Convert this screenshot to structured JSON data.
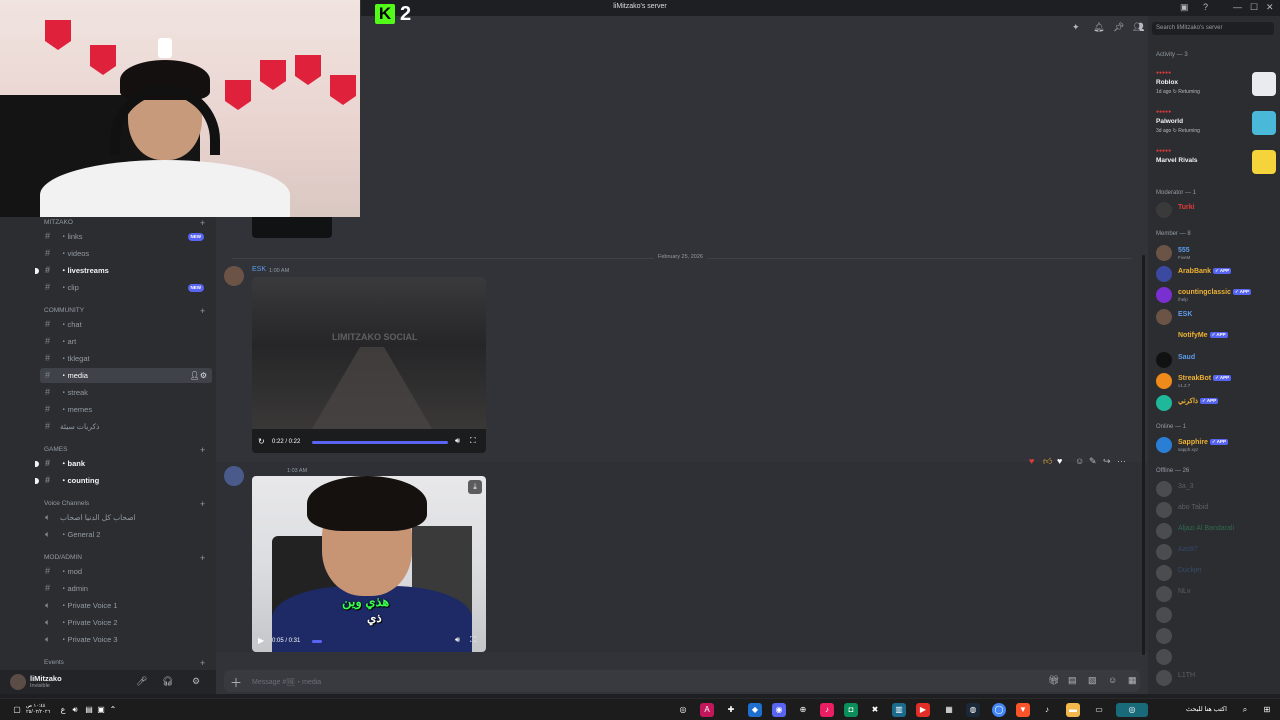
{
  "window": {
    "title": "liMitzako's server",
    "controls": [
      "—",
      "☐",
      "✕"
    ]
  },
  "overlay": {
    "kick_count": "2",
    "kick_letter": "K"
  },
  "sidebar": {
    "categories": [
      {
        "label": "MITZAKO",
        "top": 0
      },
      {
        "label": "COMMUNITY"
      },
      {
        "label": "GAMES"
      },
      {
        "label": "Voice Channels"
      },
      {
        "label": "MOD/ADMIN"
      },
      {
        "label": "Events"
      }
    ],
    "channels": {
      "links": "・links",
      "videos": "・videos",
      "livestreams": "・livestreams",
      "clip": "・clip",
      "chat": "・chat",
      "art": "・art",
      "tklegat": "・tklegat",
      "media": "・media",
      "streak": "・streak",
      "memes": "・memes",
      "arabic": "ذكريات سيئة",
      "bank": "・bank",
      "counting": "・counting",
      "voice_arabic": "اصحاب كل الدنيا اصحاب",
      "general2": "・General 2",
      "mod": "・mod",
      "admin": "・admin",
      "pv1": "・Private Voice 1",
      "pv2": "・Private Voice 2",
      "pv3": "・Private Voice 3"
    },
    "new_badge": "NEW"
  },
  "user": {
    "name": "liMitzako",
    "status": "Invisible"
  },
  "chat": {
    "date_divider": "February 25, 2026",
    "msg1": {
      "author": "ESK",
      "time": "1:00 AM",
      "video_time": "0:22 / 0:22",
      "watermark": "LIMITZAKO SOCIAL"
    },
    "msg2": {
      "author": "",
      "time": "1:03 AM",
      "video_time": "0:05 / 0:31",
      "caption1": "هذي وين",
      "caption2": "ذي"
    },
    "composer_placeholder": "Message #🖼・media"
  },
  "members": {
    "search_placeholder": "Search liMitzako's server",
    "activity_header": "Activity — 3",
    "activities": [
      {
        "game": "Roblox",
        "meta": "1d ago  ↻ Returning",
        "color": "#e9ecef"
      },
      {
        "game": "Palworld",
        "meta": "3d ago  ↻ Returning",
        "color": "#4ab9d9"
      },
      {
        "game": "Marvel Rivals",
        "meta": "",
        "color": "#f5d33a"
      }
    ],
    "moderator_header": "Moderator — 1",
    "moderator": {
      "name": "Turki",
      "color": "#e23b3b"
    },
    "member_header": "Member — 8",
    "list": [
      {
        "name": "555",
        "sub": "FiveM",
        "color": "#5d9cec",
        "tag": ""
      },
      {
        "name": "ArabBank",
        "sub": "",
        "color": "#f0b232",
        "tag": "✓ APP"
      },
      {
        "name": "countingclassic",
        "sub": "/help",
        "color": "#f0b232",
        "tag": "✓ APP"
      },
      {
        "name": "ESK",
        "sub": "",
        "color": "#5d9cec",
        "tag": ""
      },
      {
        "name": "NotifyMe",
        "sub": "",
        "color": "#f0b232",
        "tag": "✓ APP"
      },
      {
        "name": "Saud",
        "sub": "",
        "color": "#5d9cec",
        "tag": ""
      },
      {
        "name": "StreakBot",
        "sub": "v1.2.7",
        "color": "#f0b232",
        "tag": "✓ APP"
      },
      {
        "name": "ذاكرني",
        "sub": "",
        "color": "#f0b232",
        "tag": "✓ APP"
      }
    ],
    "online_header": "Online — 1",
    "online": {
      "name": "Sapphire",
      "sub": "sapph.xyz",
      "color": "#f0b232",
      "tag": "✓ APP"
    },
    "offline_header": "Offline — 26",
    "offline": [
      "3a_3",
      "abo Tabid",
      "Aljazi Al Bandarali",
      "Azo97",
      "Duckjet",
      "NLv",
      "...",
      "...",
      "...",
      "...",
      "...",
      "L1TH",
      "..."
    ]
  },
  "taskbar": {
    "search_text": "اكتب هنا للبحث",
    "clock": "١٠:٤٤ ص\n٢٥/٠٢/٢٠٢٦"
  }
}
